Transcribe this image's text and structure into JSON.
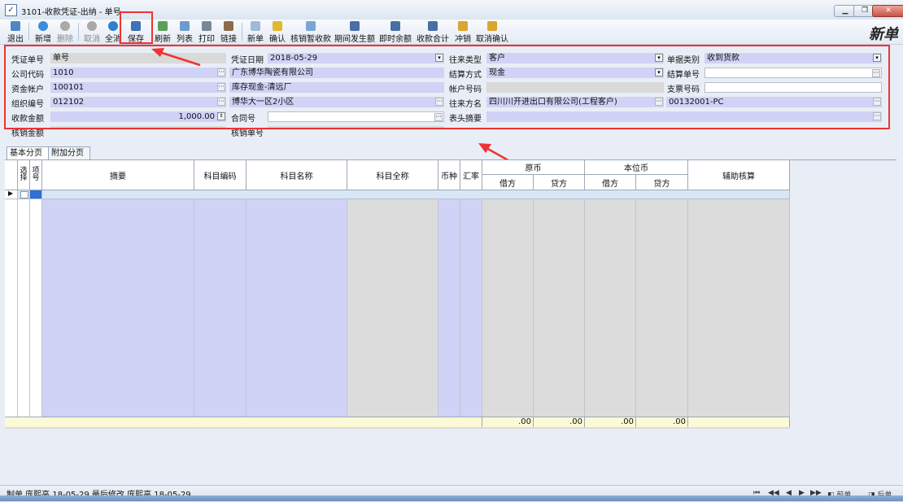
{
  "window": {
    "title": "3101-收款凭证-出纳 - 单号",
    "controls": [
      "minimize",
      "restore",
      "close"
    ]
  },
  "mode_label": "新单",
  "toolbar": [
    {
      "label": "退出",
      "icon": "home-icon",
      "enabled": true
    },
    {
      "label": "新增",
      "icon": "add-icon",
      "enabled": true
    },
    {
      "label": "删除",
      "icon": "delete-icon",
      "enabled": false
    },
    {
      "label": "取消",
      "icon": "cancel-icon",
      "enabled": false
    },
    {
      "label": "全消",
      "icon": "refresh-all-icon",
      "enabled": true
    },
    {
      "label": "保存",
      "icon": "save-icon",
      "enabled": true
    },
    {
      "label": "刷新",
      "icon": "refresh-icon",
      "enabled": true
    },
    {
      "label": "列表",
      "icon": "list-icon",
      "enabled": true
    },
    {
      "label": "打印",
      "icon": "print-icon",
      "enabled": true
    },
    {
      "label": "链接",
      "icon": "link-icon",
      "enabled": true
    },
    {
      "label": "新单",
      "icon": "new-doc-icon",
      "enabled": true
    },
    {
      "label": "确认",
      "icon": "confirm-icon",
      "enabled": true
    },
    {
      "label": "核销暂收款",
      "icon": "writeoff-icon",
      "enabled": true
    },
    {
      "label": "期间发生额",
      "icon": "period-icon",
      "enabled": true
    },
    {
      "label": "即时余额",
      "icon": "balance-icon",
      "enabled": true
    },
    {
      "label": "收款合计",
      "icon": "sum-icon",
      "enabled": true
    },
    {
      "label": "冲销",
      "icon": "reverse-icon",
      "enabled": true
    },
    {
      "label": "取消确认",
      "icon": "unconfirm-icon",
      "enabled": true
    }
  ],
  "form": {
    "voucher_no": {
      "label": "凭证单号",
      "value": "单号"
    },
    "company_code": {
      "label": "公司代码",
      "value": "1010",
      "name": "广东博华陶瓷有限公司"
    },
    "fund_account": {
      "label": "资金帐户",
      "value": "100101",
      "name": "库存现金-清远厂"
    },
    "org_code": {
      "label": "组织编号",
      "value": "012102",
      "name": "博华大一区2小区"
    },
    "amount": {
      "label": "收款金额",
      "value": "1,000.00"
    },
    "writeoff_amount": {
      "label": "核销金额",
      "value": ""
    },
    "voucher_date": {
      "label": "凭证日期",
      "value": "2018-05-29"
    },
    "contract_no": {
      "label": "合同号",
      "value": ""
    },
    "writeoff_no": {
      "label": "核销单号",
      "value": ""
    },
    "party_type": {
      "label": "往来类型",
      "value": "客户"
    },
    "settle_method": {
      "label": "结算方式",
      "value": "现金"
    },
    "account_no": {
      "label": "帐户号码",
      "value": ""
    },
    "party": {
      "label": "往来方名",
      "value": "四川川开进出口有限公司(工程客户)",
      "code": "00132001-PC"
    },
    "header_summary": {
      "label": "表头摘要",
      "value": ""
    },
    "doc_category": {
      "label": "单据类别",
      "value": "收到货款"
    },
    "settle_no": {
      "label": "结算单号",
      "value": ""
    },
    "check_no": {
      "label": "支票号码",
      "value": ""
    }
  },
  "tabs": [
    "基本分页",
    "附加分页"
  ],
  "grid": {
    "headers": {
      "select": "选择",
      "line": "项号",
      "summary": "摘要",
      "subject_code": "科目编码",
      "subject_name": "科目名称",
      "subject_full": "科目全称",
      "currency": "币种",
      "rate": "汇率",
      "orig": "原币",
      "base": "本位币",
      "debit": "借方",
      "credit": "贷方",
      "aux": "辅助核算"
    },
    "totals": [
      ".00",
      ".00",
      ".00",
      ".00"
    ]
  },
  "status": {
    "text": "制单 庞熙高 18-05-29 最后修改 庞熙高 18-05-29",
    "prev": "前单",
    "next": "后单"
  },
  "colors": {
    "lavender": "#d0d2f6",
    "grey": "#d9d9d9",
    "highlight": "#e33333"
  }
}
